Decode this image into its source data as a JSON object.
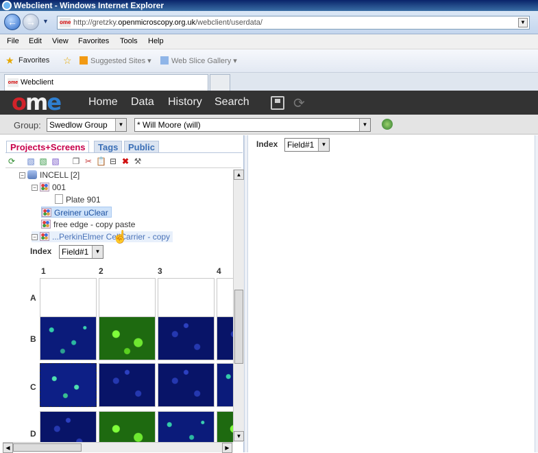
{
  "window": {
    "title": "Webclient - Windows Internet Explorer"
  },
  "address": {
    "url_prefix": "http://gretzky.",
    "url_domain": "openmicroscopy.org.uk",
    "url_path": "/webclient/userdata/",
    "favicon": "ome"
  },
  "menu": [
    "File",
    "Edit",
    "View",
    "Favorites",
    "Tools",
    "Help"
  ],
  "favorites_bar": {
    "favorites": "Favorites",
    "suggested": "Suggested Sites",
    "slice": "Web Slice Gallery"
  },
  "browser_tab": {
    "label": "Webclient"
  },
  "ome_nav": {
    "logo_o": "o",
    "logo_m": "m",
    "logo_e": "e",
    "items": [
      "Home",
      "Data",
      "History",
      "Search"
    ]
  },
  "group_bar": {
    "label": "Group:",
    "group": "Swedlow Group",
    "user": "* Will Moore (will)"
  },
  "left_tabs": [
    "Projects+Screens",
    "Tags",
    "Public"
  ],
  "tree": {
    "root": "INCELL [2]",
    "items": [
      {
        "label": "001"
      },
      {
        "label": "Plate 901"
      },
      {
        "label": "Greiner uClear"
      },
      {
        "label": "free edge - copy paste"
      },
      {
        "label": "...PerkinElmer CellCarrier - copy"
      }
    ]
  },
  "plate": {
    "index_label": "Index",
    "field_value": "Field#1",
    "columns": [
      "1",
      "2",
      "3",
      "4"
    ],
    "rows": [
      "A",
      "B",
      "C",
      "D"
    ]
  },
  "right_panel": {
    "index_label": "Index",
    "field_value": "Field#1"
  }
}
